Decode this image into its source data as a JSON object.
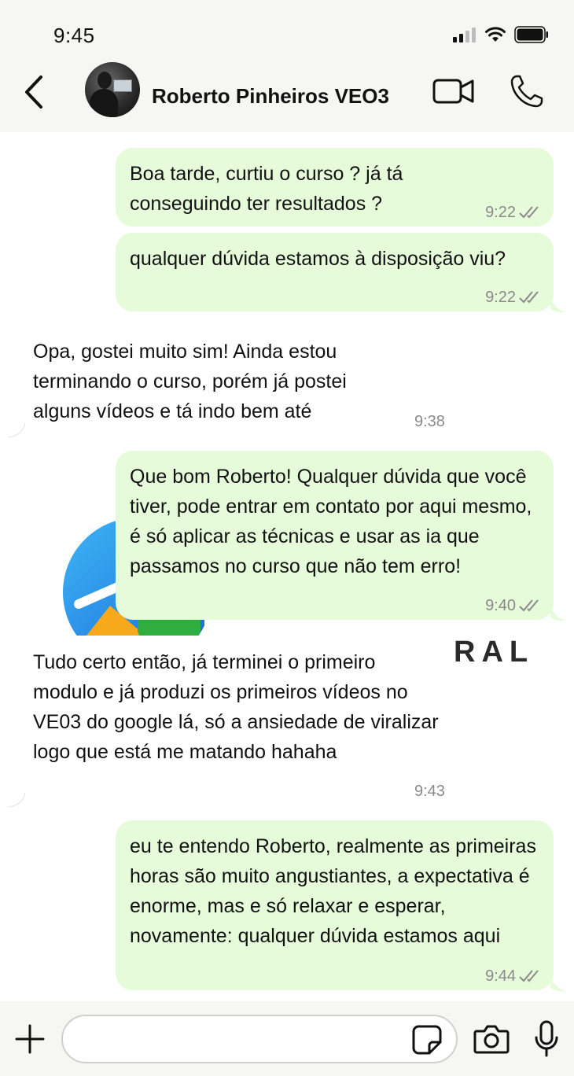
{
  "status_bar": {
    "time": "9:45",
    "icons": [
      "cellular-signal-icon",
      "wifi-icon",
      "battery-icon"
    ]
  },
  "header": {
    "contact_name": "Roberto Pinheiros VEO3",
    "icons": [
      "back-chevron-icon",
      "video-call-icon",
      "phone-icon"
    ]
  },
  "colors": {
    "outgoing_bubble": "#e6fbd9",
    "incoming_bubble": "#ffffff",
    "header_bg": "#f6f6f3",
    "timestamp": "#8a8a8a"
  },
  "background_watermark": {
    "text": "RAL"
  },
  "messages": [
    {
      "direction": "outgoing",
      "text": "Boa tarde, curtiu o curso ? já tá conseguindo ter resultados ?",
      "time": "9:22",
      "status": "read"
    },
    {
      "direction": "outgoing",
      "text": "qualquer dúvida estamos à disposição viu?",
      "time": "9:22",
      "status": "read"
    },
    {
      "direction": "incoming",
      "text": "Opa, gostei muito sim! Ainda estou terminando o curso, porém já postei alguns vídeos e tá indo bem até",
      "time": "9:38"
    },
    {
      "direction": "outgoing",
      "text": "Que bom Roberto! Qualquer dúvida que você tiver, pode entrar em contato por aqui mesmo, é só aplicar as técnicas e usar as ia que passamos no curso que não tem erro!",
      "time": "9:40",
      "status": "read"
    },
    {
      "direction": "incoming",
      "text": "Tudo certo então, já terminei o primeiro modulo e já produzi os primeiros vídeos no VE03 do google lá, só a ansiedade de viralizar logo que está me matando hahaha",
      "time": "9:43"
    },
    {
      "direction": "outgoing",
      "text": "eu te entendo Roberto, realmente as primeiras horas são muito angustiantes, a expectativa é enorme, mas e só relaxar e esperar, novamente: qualquer dúvida estamos aqui",
      "time": "9:44",
      "status": "read"
    }
  ],
  "composer": {
    "value": "",
    "icons": [
      "plus-icon",
      "sticker-icon",
      "camera-icon",
      "microphone-icon"
    ]
  }
}
